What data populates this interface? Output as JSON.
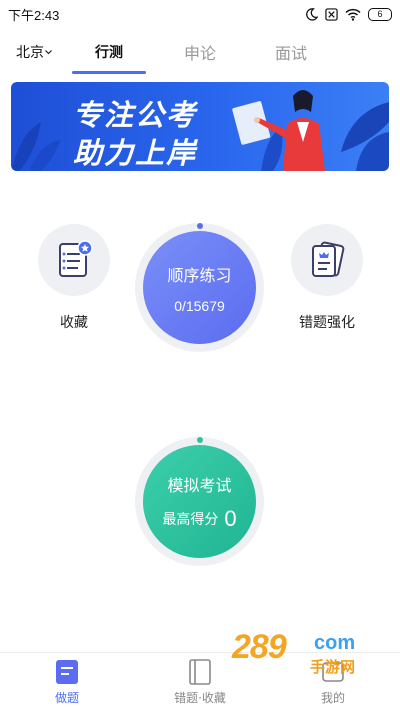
{
  "status_bar": {
    "time": "下午2:43",
    "battery": "6",
    "icons": [
      "moon-icon",
      "sim-off-icon",
      "wifi-icon",
      "battery-icon"
    ]
  },
  "top_nav": {
    "city": "北京",
    "tabs": [
      {
        "label": "行测",
        "active": true
      },
      {
        "label": "申论",
        "active": false
      },
      {
        "label": "面试",
        "active": false
      }
    ],
    "accent_color": "#4a6cf7"
  },
  "banner": {
    "line1": "专注公考",
    "line2": "助力上岸"
  },
  "main": {
    "favorites_label": "收藏",
    "wrong_questions_label": "错题强化",
    "practice": {
      "title": "顺序练习",
      "progress": "0/15679"
    },
    "mock_exam": {
      "title": "模拟考试",
      "score_label": "最高得分",
      "score_value": "0"
    }
  },
  "bottom_nav": {
    "items": [
      {
        "label": "做题",
        "icon": "doc-icon",
        "active": true
      },
      {
        "label": "错题·收藏",
        "icon": "book-icon",
        "active": false
      },
      {
        "label": "我的",
        "icon": "profile-icon",
        "active": false
      }
    ]
  },
  "watermark": {
    "number": "289",
    "suffix": "com",
    "sub": "手游网"
  }
}
